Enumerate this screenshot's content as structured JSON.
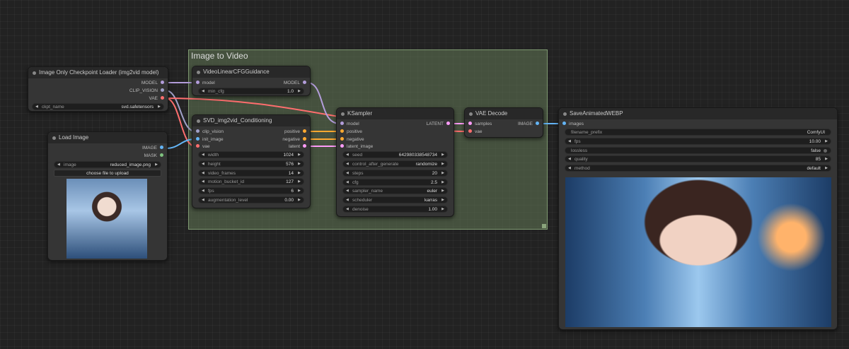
{
  "group": {
    "title": "Image to Video"
  },
  "checkpoint": {
    "title": "Image Only Checkpoint Loader (img2vid model)",
    "outputs": [
      "MODEL",
      "CLIP_VISION",
      "VAE"
    ],
    "ckpt_label": "ckpt_name",
    "ckpt_value": "svd.safetensors"
  },
  "loadimage": {
    "title": "Load Image",
    "outputs": [
      "IMAGE",
      "MASK"
    ],
    "image_label": "image",
    "image_value": "reduced_image.png",
    "upload_button": "choose file to upload"
  },
  "videocfg": {
    "title": "VideoLinearCFGGuidance",
    "input": "model",
    "output": "MODEL",
    "min_cfg_label": "min_cfg",
    "min_cfg_value": "1.0"
  },
  "svd": {
    "title": "SVD_img2vid_Conditioning",
    "inputs": [
      "clip_vision",
      "init_image",
      "vae"
    ],
    "outputs": [
      "positive",
      "negative",
      "latent"
    ],
    "widgets": [
      {
        "label": "width",
        "value": "1024"
      },
      {
        "label": "height",
        "value": "576"
      },
      {
        "label": "video_frames",
        "value": "14"
      },
      {
        "label": "motion_bucket_id",
        "value": "127"
      },
      {
        "label": "fps",
        "value": "6"
      },
      {
        "label": "augmentation_level",
        "value": "0.00"
      }
    ]
  },
  "ksampler": {
    "title": "KSampler",
    "inputs": [
      "model",
      "positive",
      "negative",
      "latent_image"
    ],
    "output": "LATENT",
    "widgets": [
      {
        "label": "seed",
        "value": "642980338548734"
      },
      {
        "label": "control_after_generate",
        "value": "randomize"
      },
      {
        "label": "steps",
        "value": "20"
      },
      {
        "label": "cfg",
        "value": "2.5"
      },
      {
        "label": "sampler_name",
        "value": "euler"
      },
      {
        "label": "scheduler",
        "value": "karras"
      },
      {
        "label": "denoise",
        "value": "1.00"
      }
    ]
  },
  "vaedecode": {
    "title": "VAE Decode",
    "inputs": [
      "samples",
      "vae"
    ],
    "output": "IMAGE"
  },
  "saveanim": {
    "title": "SaveAnimatedWEBP",
    "input": "images",
    "widgets": [
      {
        "label": "filename_prefix",
        "value": "ComfyUI"
      },
      {
        "label": "fps",
        "value": "10.00"
      },
      {
        "label": "lossless",
        "value": "false"
      },
      {
        "label": "quality",
        "value": "85"
      },
      {
        "label": "method",
        "value": "default"
      }
    ]
  },
  "colors": {
    "model": "#b39ddb",
    "clip_vision": "#a0a0c8",
    "vae": "#ff6e6e",
    "image": "#64b5f6",
    "conditioning": "#ffa931",
    "latent": "#ff9cf9"
  }
}
